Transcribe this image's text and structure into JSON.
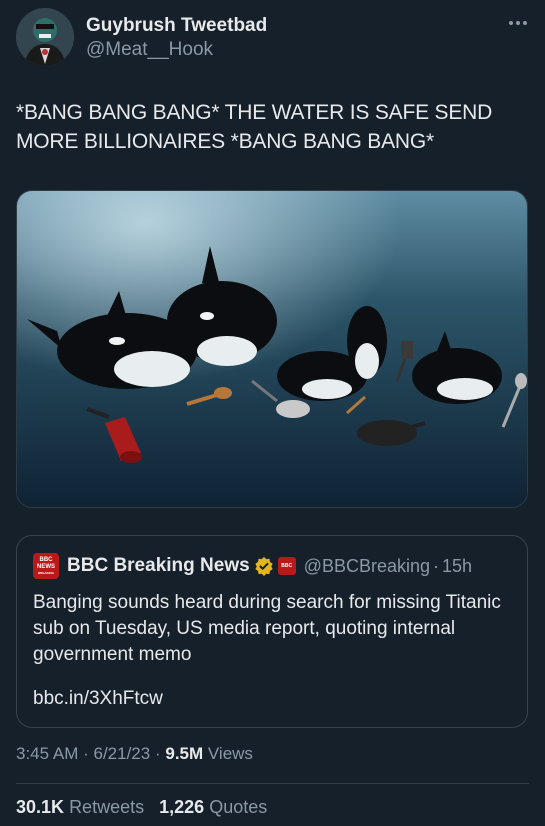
{
  "user": {
    "display_name": "Guybrush Tweetbad",
    "handle": "@Meat__Hook"
  },
  "tweet": {
    "text": "*BANG BANG BANG* THE WATER IS SAFE SEND MORE BILLIONAIRES *BANG BANG BANG*"
  },
  "quote": {
    "logo_text_1": "BBC",
    "logo_text_2": "NEWS",
    "logo_text_3": "BREAKING",
    "mini_logo_text": "BBC",
    "name": "BBC Breaking News",
    "handle": "@BBCBreaking",
    "time": "15h",
    "text": "Banging sounds heard during search for missing Titanic sub on Tuesday, US media report, quoting internal government memo",
    "link": "bbc.in/3XhFtcw"
  },
  "meta": {
    "time": "3:45 AM",
    "date": "6/21/23",
    "views_count": "9.5M",
    "views_label": "Views"
  },
  "stats": {
    "retweets_count": "30.1K",
    "retweets_label": "Retweets",
    "quotes_count": "1,226",
    "quotes_label": "Quotes"
  },
  "icons": {
    "more": "more-icon",
    "verified": "verified-badge-icon"
  },
  "colors": {
    "background": "#15202b",
    "secondary_text": "#8b98a5",
    "bbc_red": "#bb1919",
    "verified_gold": "#e2b719"
  }
}
